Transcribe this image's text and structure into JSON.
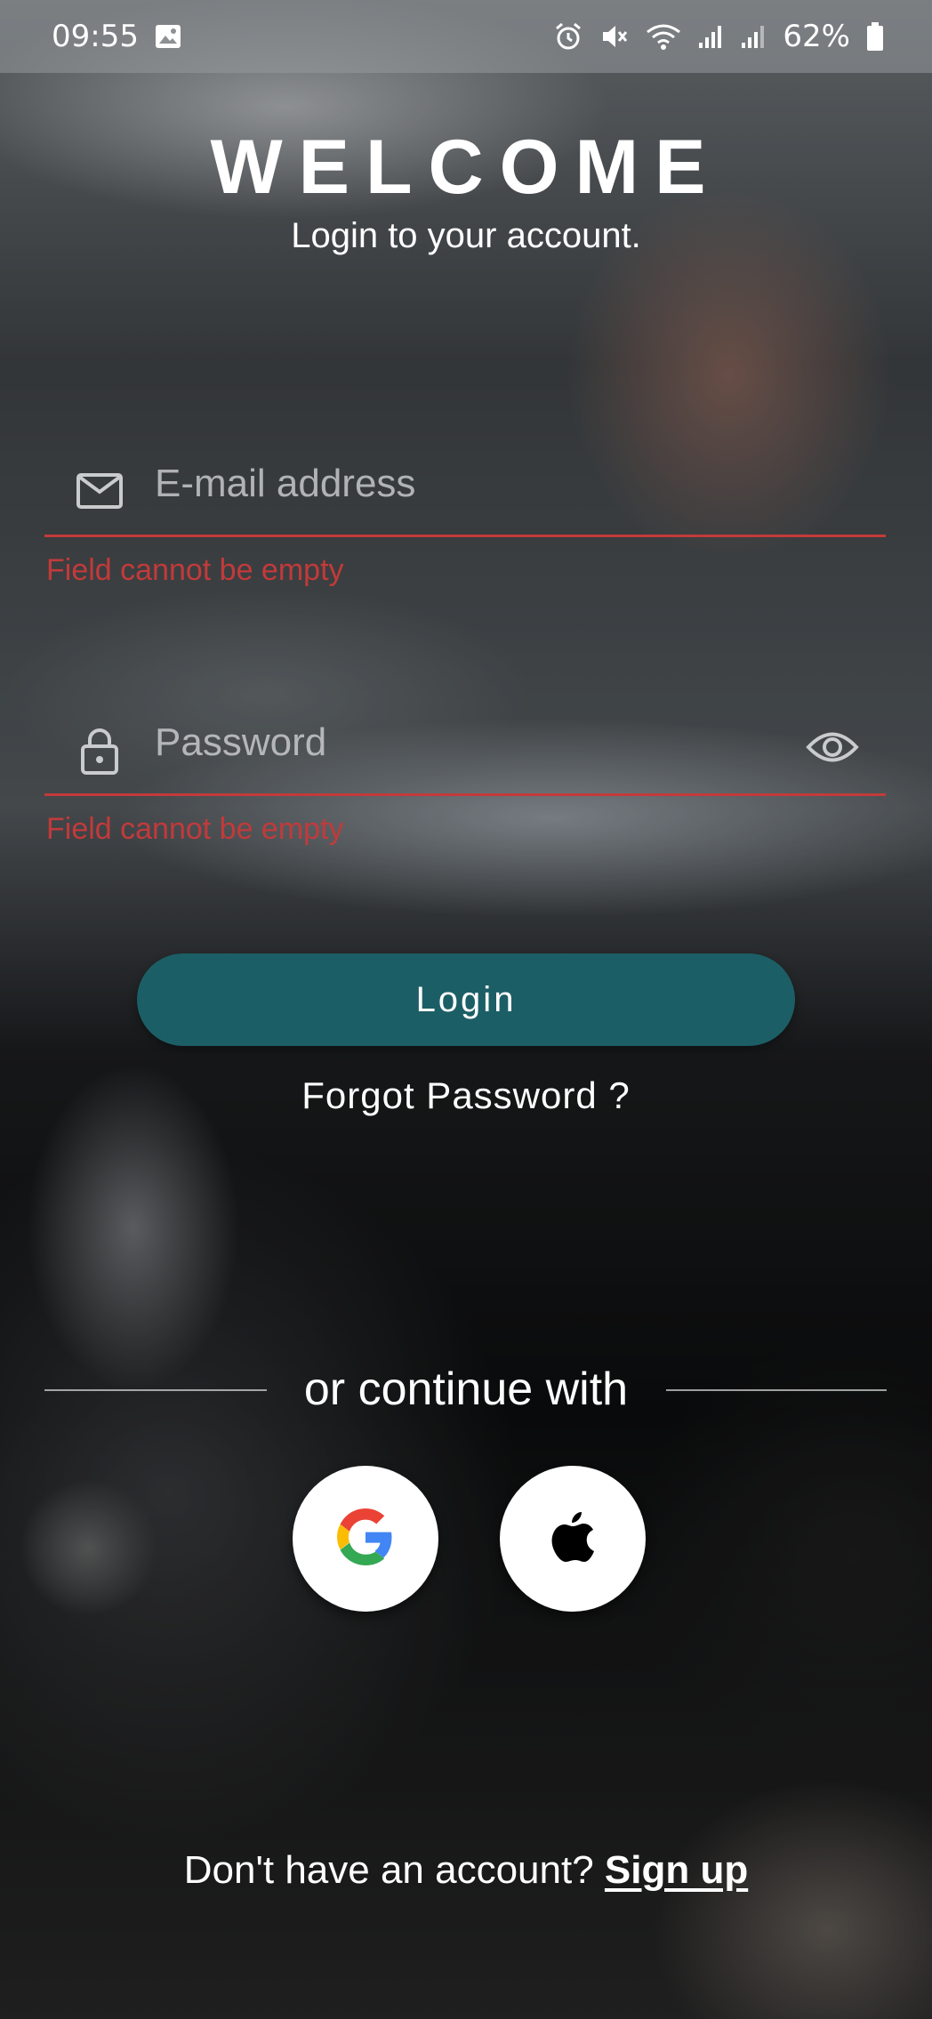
{
  "status_bar": {
    "time": "09:55",
    "battery": "62%",
    "icons": [
      "image-icon",
      "alarm-icon",
      "mute-icon",
      "wifi-icon",
      "signal-icon",
      "signal-icon",
      "battery-icon"
    ]
  },
  "header": {
    "title": "WELCOME",
    "subtitle": "Login to your account."
  },
  "form": {
    "email": {
      "placeholder": "E-mail address",
      "value": "",
      "icon": "mail-icon",
      "error": "Field cannot be empty"
    },
    "password": {
      "placeholder": "Password",
      "value": "",
      "icon": "lock-icon",
      "toggle_icon": "eye-icon",
      "error": "Field cannot be empty"
    },
    "login_label": "Login",
    "forgot_label": "Forgot Password ?"
  },
  "social": {
    "divider_text": "or continue with",
    "providers": [
      {
        "name": "Google",
        "icon": "google-icon"
      },
      {
        "name": "Apple",
        "icon": "apple-icon"
      }
    ]
  },
  "footer": {
    "prompt": "Don't have an account? ",
    "signup_label": "Sign up"
  },
  "colors": {
    "accent": "#1c5e66",
    "error": "#c23a3a",
    "text": "#ffffff"
  }
}
